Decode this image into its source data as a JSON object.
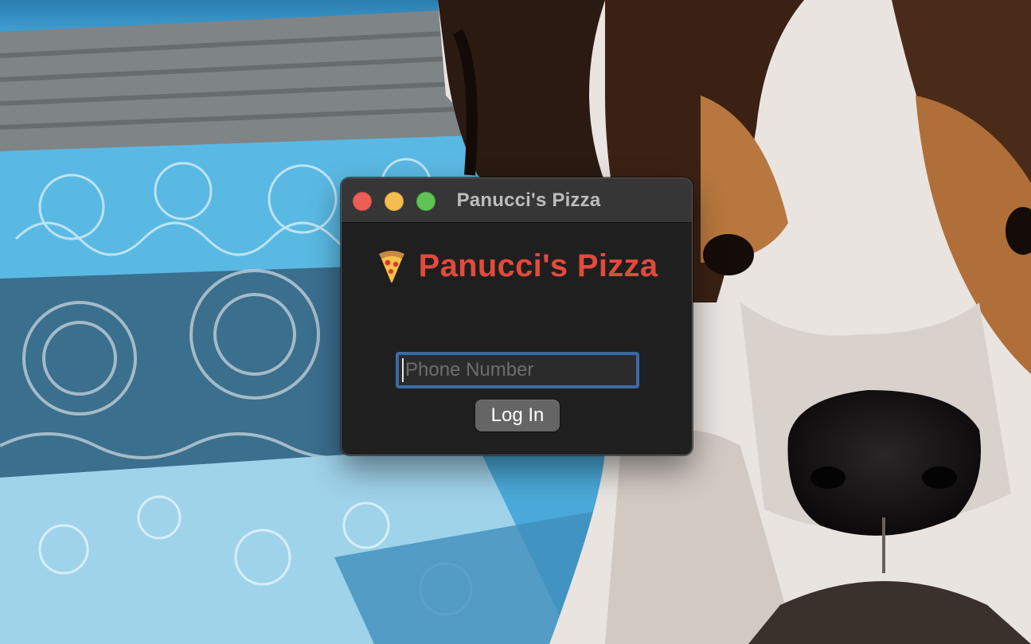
{
  "desktop": {
    "wallpaper_icon": "photo-wallpaper-icon"
  },
  "window": {
    "title": "Panucci's Pizza",
    "buttons": {
      "close_color": "#ec5f57",
      "minimize_color": "#f5bd4f",
      "zoom_color": "#5fc454"
    }
  },
  "main": {
    "heading_icon": "pizza-slice-icon",
    "heading": "Panucci's Pizza",
    "heading_color": "#e24a3b",
    "phone_input": {
      "value": "",
      "placeholder": "Phone Number"
    },
    "login_button_label": "Log In"
  }
}
